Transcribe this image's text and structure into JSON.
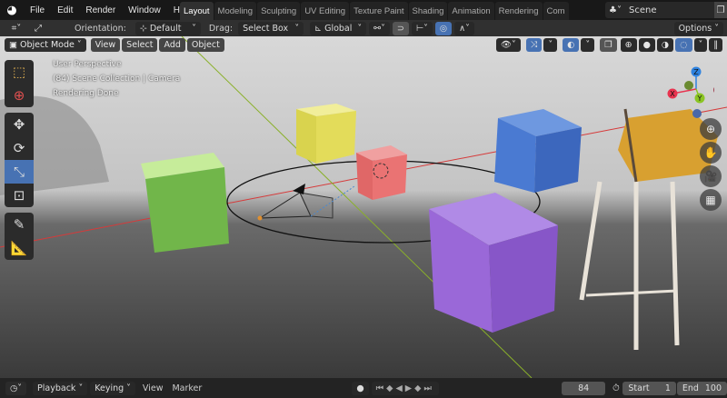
{
  "menubar": {
    "items": [
      "File",
      "Edit",
      "Render",
      "Window",
      "Help"
    ],
    "workspaces": [
      "Layout",
      "Modeling",
      "Sculpting",
      "UV Editing",
      "Texture Paint",
      "Shading",
      "Animation",
      "Rendering",
      "Com"
    ],
    "active_workspace": "Layout",
    "scene": "Scene"
  },
  "tool_header": {
    "orientation_label": "Orientation:",
    "orientation_value": "Default",
    "drag_label": "Drag:",
    "drag_value": "Select Box",
    "transform_orientation": "Global",
    "options": "Options"
  },
  "viewport_header": {
    "mode": "Object Mode",
    "menus": [
      "View",
      "Select",
      "Add",
      "Object"
    ]
  },
  "viewport": {
    "info": [
      "User Perspective",
      "(84) Scene Collection | Camera",
      "Rendering Done"
    ],
    "gizmo": {
      "x": "X",
      "y": "Y",
      "z": "Z"
    }
  },
  "timeline": {
    "menus": [
      "Playback",
      "Keying",
      "View",
      "Marker"
    ],
    "current_frame": "84",
    "start_label": "Start",
    "start": "1",
    "end_label": "End",
    "end": "100"
  },
  "colors": {
    "accent": "#4772b3",
    "x_axis": "#e8334f",
    "y_axis": "#8bc523",
    "z_axis": "#2f83e0"
  }
}
